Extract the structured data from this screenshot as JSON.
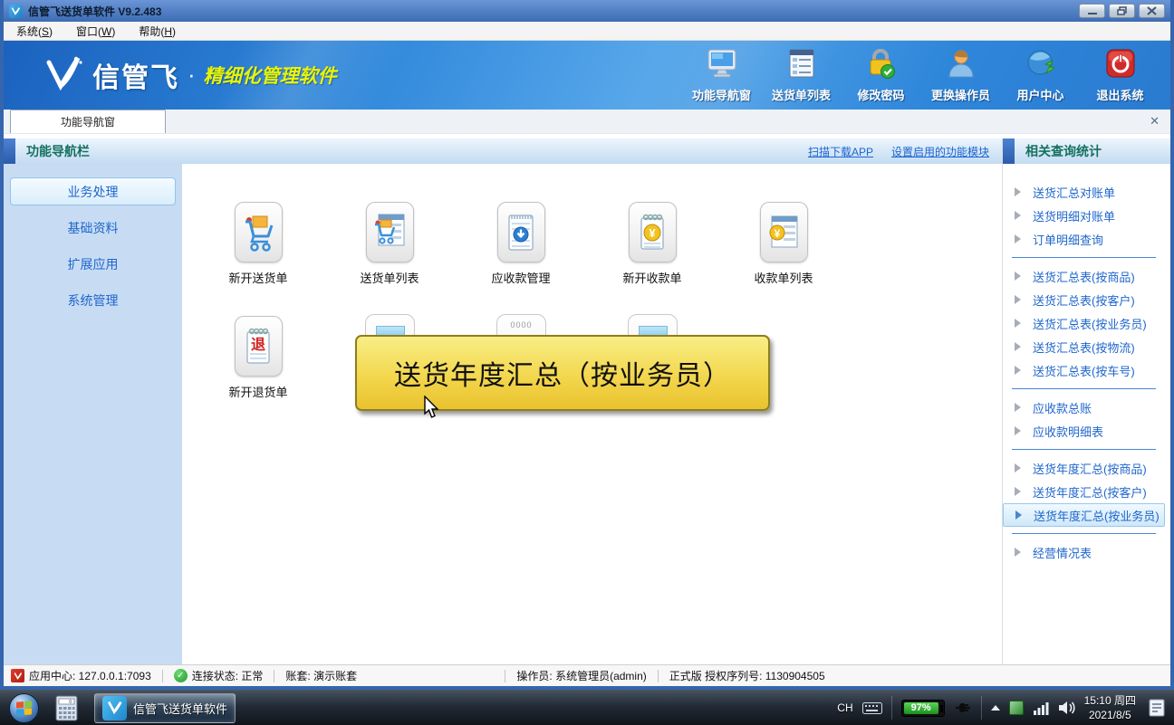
{
  "window": {
    "title": "信管飞送货单软件 V9.2.483"
  },
  "menu": {
    "items": [
      "系统(S)",
      "窗口(W)",
      "帮助(H)"
    ]
  },
  "banner": {
    "brand": "信管飞",
    "dot": "·",
    "tagline": "精细化管理软件",
    "buttons": [
      {
        "label": "功能导航窗",
        "icon": "monitor-icon"
      },
      {
        "label": "送货单列表",
        "icon": "delivery-list-icon"
      },
      {
        "label": "修改密码",
        "icon": "lock-check-icon"
      },
      {
        "label": "更换操作员",
        "icon": "operator-icon"
      },
      {
        "label": "用户中心",
        "icon": "globe-icon"
      },
      {
        "label": "退出系统",
        "icon": "power-icon"
      }
    ]
  },
  "tabs": {
    "active": "功能导航窗"
  },
  "nav": {
    "title": "功能导航栏",
    "links": [
      "扫描下载APP",
      "设置启用的功能模块"
    ]
  },
  "sidebar": {
    "items": [
      "业务处理",
      "基础资料",
      "扩展应用",
      "系统管理"
    ]
  },
  "main": {
    "row1": [
      {
        "label": "新开送货单",
        "icon": "cart-icon"
      },
      {
        "label": "送货单列表",
        "icon": "cart-list-icon"
      },
      {
        "label": "应收款管理",
        "icon": "receivable-icon"
      },
      {
        "label": "新开收款单",
        "icon": "receipt-new-icon"
      },
      {
        "label": "收款单列表",
        "icon": "receipt-list-icon"
      }
    ],
    "row2": [
      {
        "label": "新开退货单",
        "icon": "return-icon"
      }
    ],
    "tooltip": "送货年度汇总（按业务员）",
    "ghost_marker": "0000"
  },
  "query": {
    "title": "相关查询统计",
    "selected": "送货年度汇总(按业务员)",
    "groups": [
      {
        "items": [
          "送货汇总对账单",
          "送货明细对账单",
          "订单明细查询"
        ]
      },
      {
        "items": [
          "送货汇总表(按商品)",
          "送货汇总表(按客户)",
          "送货汇总表(按业务员)",
          "送货汇总表(按物流)",
          "送货汇总表(按车号)"
        ]
      },
      {
        "items": [
          "应收款总账",
          "应收款明细表"
        ]
      },
      {
        "items": [
          "送货年度汇总(按商品)",
          "送货年度汇总(按客户)",
          "送货年度汇总(按业务员)"
        ]
      },
      {
        "items": [
          "经营情况表"
        ]
      }
    ]
  },
  "status": {
    "segments": [
      "应用中心: 127.0.0.1:7093",
      "连接状态: 正常",
      "账套: 演示账套",
      "操作员: 系统管理员(admin)",
      "正式版 授权序列号: 1130904505"
    ]
  },
  "taskbar": {
    "app_button": "信管飞送货单软件",
    "tray": {
      "ime": "CH",
      "battery": "97%",
      "time": "15:10 周四",
      "date": "2021/8/5"
    }
  },
  "colors": {
    "accent_blue": "#2f7fd6",
    "link_blue": "#1b64d0",
    "header_teal": "#14705f",
    "tooltip_gold": "#eec52e",
    "battery_green": "#2fae3a",
    "brand_yellow": "#e9f400"
  }
}
